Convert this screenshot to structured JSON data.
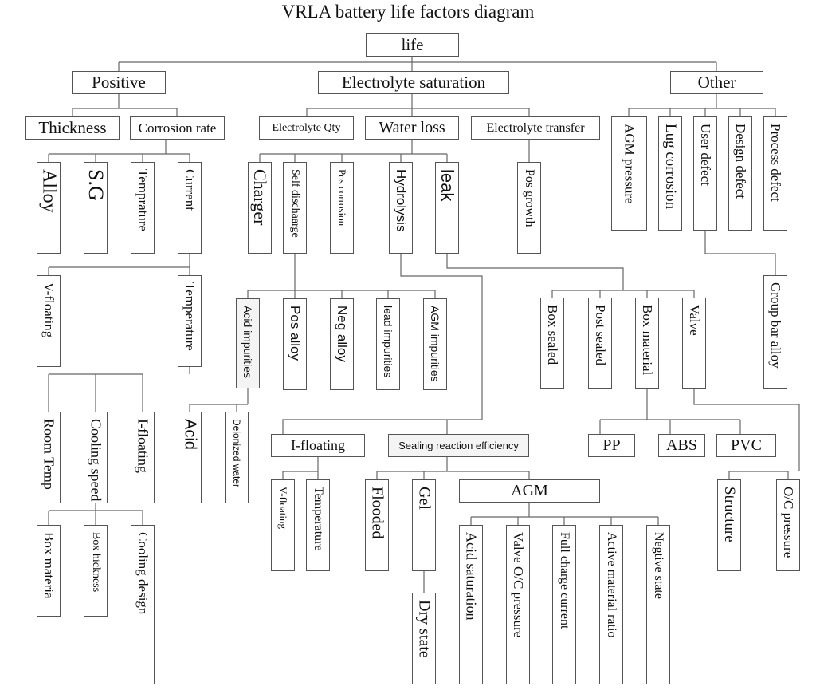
{
  "title": "VRLA battery life factors diagram",
  "nodes": {
    "life": "life",
    "positive": "Positive",
    "electrolyte_saturation": "Electrolyte saturation",
    "other": "Other",
    "thickness": "Thickness",
    "corrosion_rate": "Corrosion rate",
    "alloy": "Alloy",
    "sg": "S.G",
    "temprature": "Temprature",
    "current": "Current",
    "v_floating_1": "V-floating",
    "temperature_1": "Temperature",
    "room_temp": "Room Temp",
    "cooling_speed": "Cooling speed",
    "i_floating_1": "I-floating",
    "box_materia": "Box materia",
    "box_hickness": "Box hickness",
    "cooling_design": "Cooling design",
    "electrolyte_qty": "Electrolyte Qty",
    "water_loss": "Water loss",
    "electrolyte_transfer": "Electrolyte transfer",
    "charger": "Charger",
    "self_discharge": "Self dischaarge",
    "pos_corrosion": "Pos corrosion",
    "hydrolysis": "Hydrolysis",
    "leak": "leak",
    "pos_growth": "Pos growth",
    "acid_impurities": "Acid impurities",
    "pos_alloy": "Pos alloy",
    "neg_alloy": "Neg alloy",
    "lead_impurities": "lead impurities",
    "agm_impurities": "AGM impurities",
    "acid": "Acid",
    "deionized_water": "Deionized water",
    "i_floating_2": "I-floating",
    "sealing_reaction_efficiency": "Sealing reaction efficiency",
    "v_floating_2": "V-floating",
    "temperature_2": "Temperature",
    "flooded": "Flooded",
    "gel": "Gel",
    "dry_state": "Dry state",
    "agm": "AGM",
    "acid_saturation": "Acid saturation",
    "valve_oc_pressure": "Valve O/C pressure",
    "full_charge_current": "Full charge current",
    "active_material_ratio": "Active material ratio",
    "negtive_state": "Negtive state",
    "box_sealed": "Box sealed",
    "post_sealed": "Post sealed",
    "box_material": "Box material",
    "valve": "Valve",
    "pp": "PP",
    "abs": "ABS",
    "pvc": "PVC",
    "structure": "Structure",
    "oc_pressure": "O/C pressure",
    "agm_pressure": "AGM pressure",
    "lug_corrosion": "Lug corrosion",
    "user_defect": "User defect",
    "design_defect": "Design defect",
    "process_defect": "Process defect",
    "group_bar_alloy": "Group bar alloy"
  }
}
